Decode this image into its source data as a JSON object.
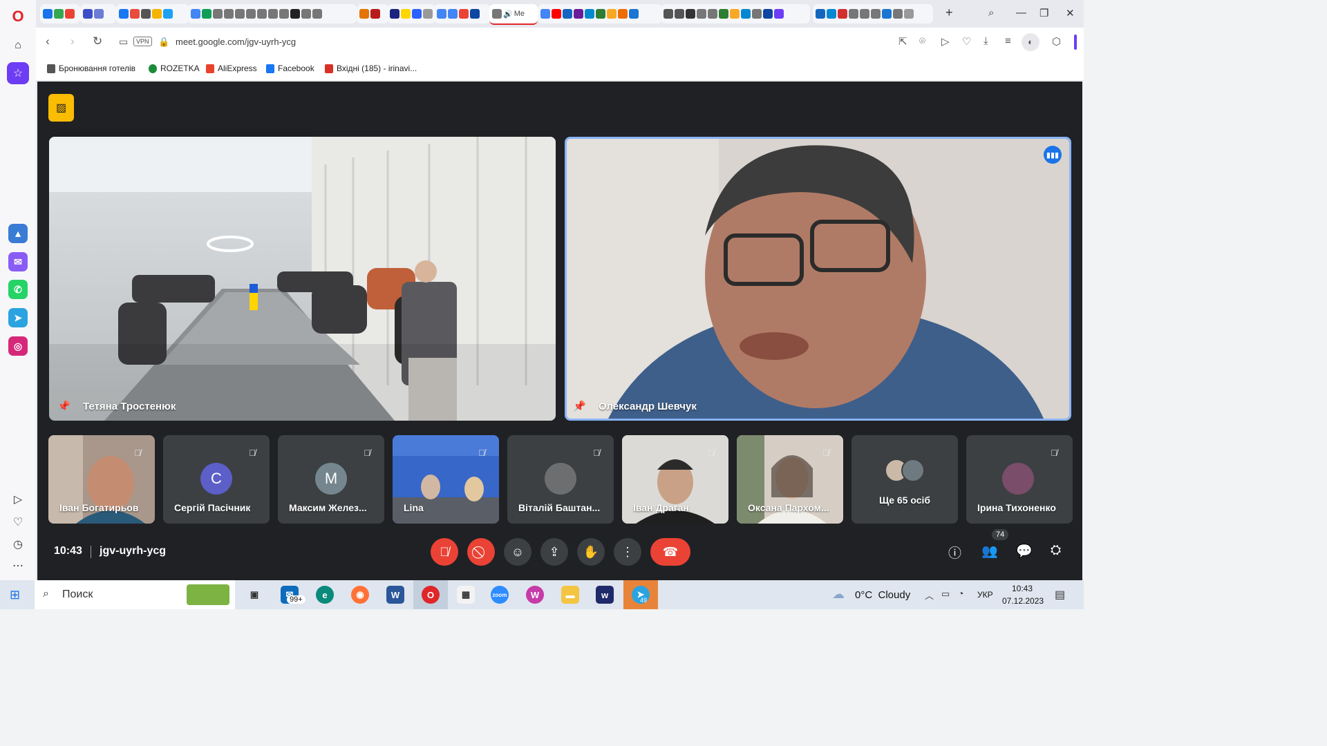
{
  "browser": {
    "url": "meet.google.com/jgv-uyrh-ycg",
    "vpn_label": "VPN",
    "active_tab_label": "Me",
    "bookmarks": [
      {
        "label": "Бронювання готелів",
        "color": "#555555"
      },
      {
        "label": "ROZETKA",
        "color": "#1c8b3a"
      },
      {
        "label": "AliExpress",
        "color": "#e8432b"
      },
      {
        "label": "Facebook",
        "color": "#1877f2"
      },
      {
        "label": "Вхідні (185) - irinavi...",
        "color": "#d93025"
      }
    ]
  },
  "meet": {
    "main_tiles": [
      {
        "name": "Тетяна Тростенюк"
      },
      {
        "name": "Олександр Шевчук"
      }
    ],
    "participants": [
      {
        "name": "Іван Богатирьов"
      },
      {
        "name": "Сергій Пасічник",
        "initial": "С",
        "color": "#5b5fc7"
      },
      {
        "name": "Максим Желез...",
        "initial": "М",
        "color": "#75868e"
      },
      {
        "name": "Lina"
      },
      {
        "name": "Віталій Баштан..."
      },
      {
        "name": "Іван Драган"
      },
      {
        "name": "Оксана Пархом..."
      },
      {
        "name": "Ще 65 осіб"
      },
      {
        "name": "Ірина Тихоненко"
      }
    ],
    "clock": "10:43",
    "meeting_code": "jgv-uyrh-ycg",
    "people_count": "74"
  },
  "taskbar": {
    "search_label": "Поиск",
    "mail_badge": "99+",
    "telegram_badge": "49",
    "weather": "0°C  Cloudy",
    "lang": "УКР",
    "time": "10:43",
    "date": "07.12.2023"
  }
}
